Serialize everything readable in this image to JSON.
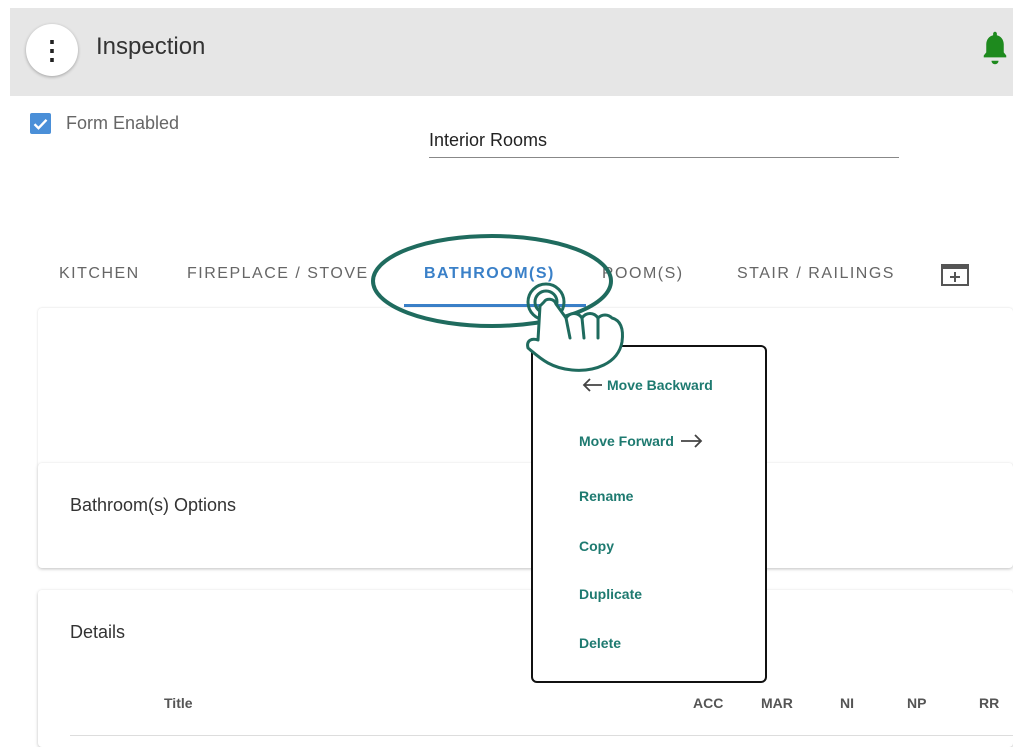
{
  "header": {
    "menu_icon": "more-vert-icon",
    "title": "Inspection",
    "notification_icon": "bell-icon",
    "notification_color": "#1e8a1e"
  },
  "form": {
    "enabled_checked": true,
    "enabled_label": "Form Enabled",
    "name_value": "Interior Rooms"
  },
  "tabs": {
    "items": [
      "KITCHEN",
      "FIREPLACE / STOVE",
      "BATHROOM(S)",
      "ROOM(S)",
      "STAIR / RAILINGS"
    ],
    "active_index": 2,
    "active_color": "#3a80c8",
    "add_icon": "add-tab-icon"
  },
  "options_card": {
    "title": "Bathroom(s) Options"
  },
  "details_card": {
    "title": "Details",
    "columns": [
      "Title",
      "ACC",
      "MAR",
      "NI",
      "NP",
      "RR"
    ]
  },
  "context_menu": {
    "accent_color": "#1e7a70",
    "items": [
      "Move Backward",
      "Move Forward",
      "Rename",
      "Copy",
      "Duplicate",
      "Delete"
    ]
  },
  "annotation": {
    "highlight_color": "#1f6b5e",
    "pointer_icon": "tap-hand-icon"
  }
}
